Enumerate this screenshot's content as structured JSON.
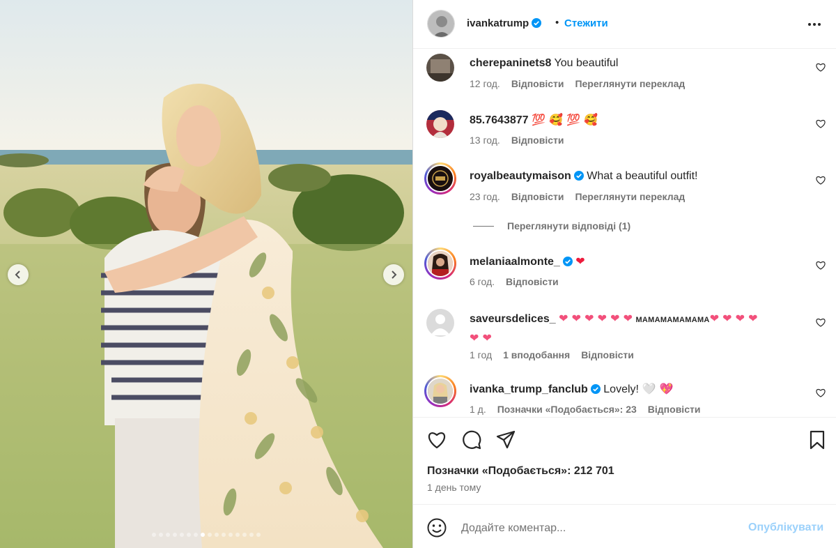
{
  "photo": {
    "description_alt": "",
    "prev_icon": "chevron-left-icon",
    "next_icon": "chevron-right-icon",
    "dots_total": 16,
    "dots_active": 8
  },
  "header": {
    "username": "ivankatrump",
    "verified": true,
    "separator": "•",
    "follow_label": "Стежити",
    "more_icon": "more-options-icon"
  },
  "comments": [
    {
      "username": "cherepaninets8",
      "verified": false,
      "text": "You beautiful",
      "time": "12 год.",
      "likes": "",
      "reply": "Відповісти",
      "translate": "Переглянути переклад"
    },
    {
      "username": "85.7643877",
      "verified": false,
      "text": "💯 🥰 💯 🥰",
      "time": "13 год.",
      "likes": "",
      "reply": "Відповісти",
      "translate": ""
    },
    {
      "username": "royalbeautymaison",
      "verified": true,
      "text": "What a beautiful outfit!",
      "time": "23 год.",
      "likes": "",
      "reply": "Відповісти",
      "translate": "Переглянути переклад"
    },
    {
      "username": "melaniaalmonte_",
      "verified": true,
      "text": "❤",
      "time": "6 год.",
      "likes": "",
      "reply": "Відповісти",
      "translate": ""
    },
    {
      "username": "saveursdelices_",
      "verified": false,
      "text_hearts_before": "❤ ❤ ❤ ❤ ❤ ❤",
      "text_word": "MAMAMAMAMAMA",
      "text_hearts_after": "❤ ❤ ❤ ❤",
      "text_line2": "❤ ❤",
      "time": "1 год",
      "likes": "1 вподобання",
      "reply": "Відповісти",
      "translate": ""
    },
    {
      "username": "ivanka_trump_fanclub",
      "verified": true,
      "text": "Lovely!",
      "text_emoji": "🤍 💖",
      "time": "1 д.",
      "likes": "Позначки «Подобається»: 23",
      "reply": "Відповісти",
      "translate": ""
    }
  ],
  "view_replies": "Переглянути відповіді (1)",
  "actions": {
    "like_icon": "heart-icon",
    "comment_icon": "comment-icon",
    "share_icon": "share-icon",
    "save_icon": "bookmark-icon"
  },
  "likes_text": "Позначки «Подобається»: 212 701",
  "posted_time": "1 день тому",
  "composer": {
    "emoji_icon": "smiley-icon",
    "placeholder": "Додайте коментар...",
    "post_label": "Опублікувати"
  },
  "colors": {
    "link_blue": "#0095f6",
    "post_disabled": "#9bd1fb",
    "muted": "#737373",
    "text": "#262626"
  }
}
